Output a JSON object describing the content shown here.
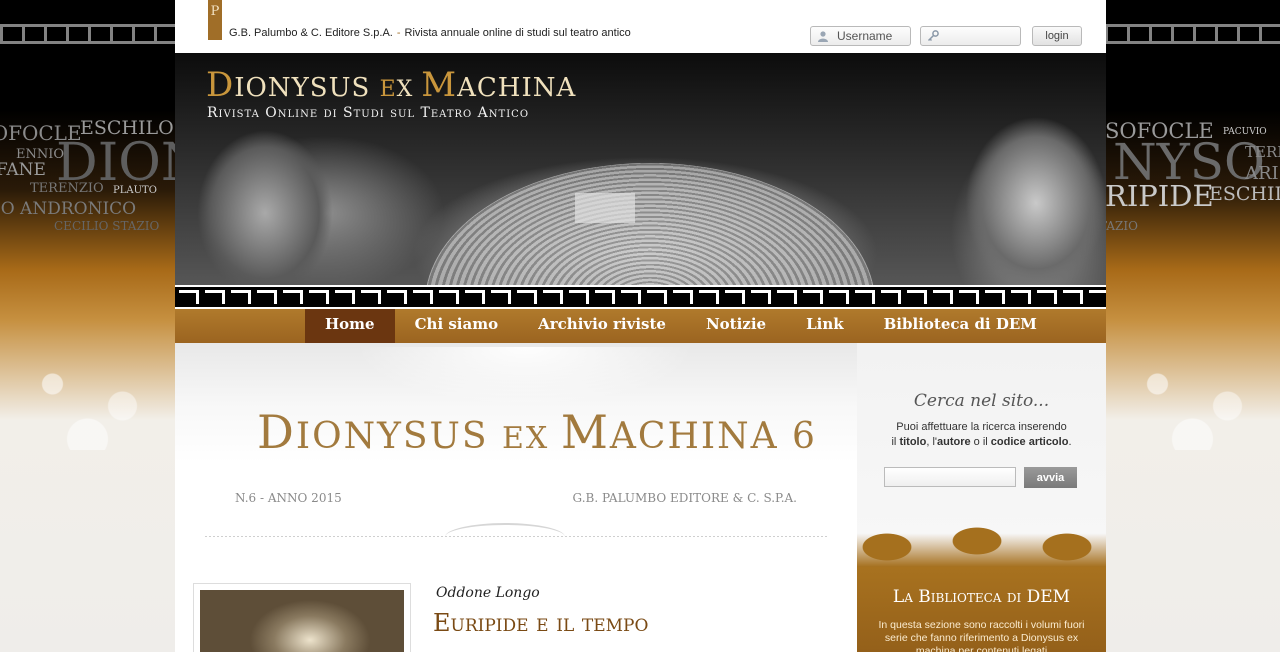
{
  "colors": {
    "gold": "#a06e28",
    "nav": "#a36c24",
    "nav_active": "#6b3610",
    "title_gold": "#a27a3e"
  },
  "side": {
    "left_words": [
      "Sofocle",
      "Eschilo",
      "Ennio",
      "Dion",
      "Fane",
      "Terenzio",
      "Plauto",
      "io Andronico",
      "Cecilio Stazio"
    ],
    "right_words": [
      "Sofocle",
      "Pacuvio",
      "Nyso",
      "Teren",
      "Aris",
      "ripide",
      "Eschilo",
      "tazio"
    ]
  },
  "topbar": {
    "logo_letter": "P",
    "publisher": "G.B. Palumbo & C. Editore S.p.A.",
    "separator": "-",
    "tagline": "Rivista annuale online di studi sul teatro antico",
    "username_placeholder": "Username",
    "password_placeholder": "",
    "login_label": "login"
  },
  "banner": {
    "title_d": "D",
    "title_1": "ionysus ",
    "title_ex_e": "E",
    "title_ex_x": "x ",
    "title_m": "M",
    "title_2": "achina",
    "subtitle": "Rivista Online di Studi sul Teatro Antico"
  },
  "nav": {
    "items": [
      "Home",
      "Chi siamo",
      "Archivio riviste",
      "Notizie",
      "Link",
      "Biblioteca di DEM"
    ]
  },
  "issue": {
    "t_d": "D",
    "t_1": "ionysus ",
    "t_e": "E",
    "t_x": "x ",
    "t_m": "M",
    "t_2": "achina 6",
    "year": "N.6 - ANNO 2015",
    "publisher": "G.B. PALUMBO EDITORE & C. S.P.A."
  },
  "article": {
    "author": "Oddone Longo",
    "title": "Euripide e il tempo"
  },
  "sidebar": {
    "search_title": "Cerca nel sito...",
    "search_line1": "Puoi affettuare la ricerca inserendo",
    "search_l2a": "il ",
    "search_titolo": "titolo",
    "search_l2b": ", l'",
    "search_autore": "autore",
    "search_l2c": " o il ",
    "search_codice": "codice articolo",
    "search_l2d": ".",
    "search_button": "avvia",
    "library_title": "La Biblioteca di DEM",
    "library_text": "In questa sezione sono raccolti i volumi fuori serie che fanno riferimento a Dionysus ex machina per contenuti legati"
  }
}
